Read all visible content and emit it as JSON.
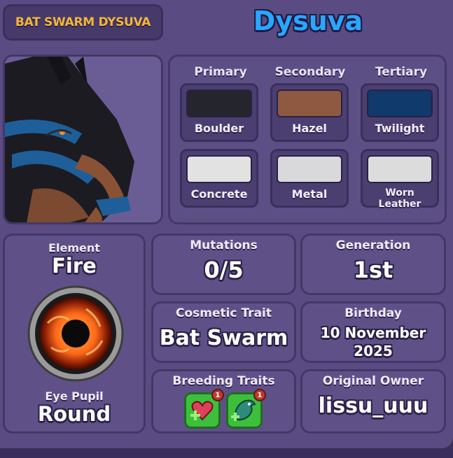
{
  "header": {
    "tag": "BAT SWARM DYSUVA",
    "name": "Dysuva"
  },
  "colors": {
    "columns": [
      "Primary",
      "Secondary",
      "Tertiary"
    ],
    "swatches": [
      {
        "label": "Boulder",
        "color": "#25262d"
      },
      {
        "label": "Hazel",
        "color": "#8d5a41"
      },
      {
        "label": "Twilight",
        "color": "#0f3a6b"
      },
      {
        "label": "Concrete",
        "color": "#e2e2e2"
      },
      {
        "label": "Metal",
        "color": "#d9d9dc"
      },
      {
        "label": "Worn Leather",
        "color": "#dcdcdc"
      }
    ]
  },
  "element": {
    "label": "Element",
    "value": "Fire",
    "eye_label": "Eye Pupil",
    "eye_value": "Round",
    "eye_icon": "fire-eye-icon"
  },
  "stats": {
    "mutations": {
      "label": "Mutations",
      "value": "0/5"
    },
    "generation": {
      "label": "Generation",
      "value": "1st"
    },
    "cosmetic": {
      "label": "Cosmetic Trait",
      "value": "Bat Swarm"
    },
    "birthday": {
      "label": "Birthday",
      "line1": "10 November",
      "line2": "2025"
    },
    "breeding": {
      "label": "Breeding Traits",
      "icons": [
        "heart-plus-icon",
        "dragon-plus-icon"
      ],
      "badges": [
        "1",
        "1"
      ]
    },
    "owner": {
      "label": "Original Owner",
      "value": "lissu_uuu"
    }
  },
  "palette": {
    "title_blue": "#2aa6ff",
    "tag_gold": "#f3b63a",
    "panel": "#5f5188",
    "background": "#3a2f5c"
  }
}
